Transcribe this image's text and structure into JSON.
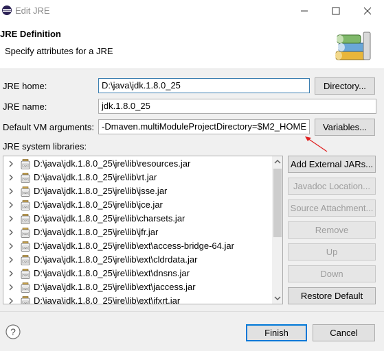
{
  "window": {
    "title": "Edit JRE"
  },
  "header": {
    "title": "JRE Definition",
    "subtitle": "Specify attributes for a JRE"
  },
  "form": {
    "jre_home_label": "JRE home:",
    "jre_home_value": "D:\\java\\jdk.1.8.0_25",
    "directory_button": "Directory...",
    "jre_name_label": "JRE name:",
    "jre_name_value": "jdk.1.8.0_25",
    "vm_args_label": "Default VM arguments:",
    "vm_args_value": "-Dmaven.multiModuleProjectDirectory=$M2_HOME",
    "variables_button": "Variables...",
    "libraries_label": "JRE system libraries:"
  },
  "libraries": [
    "D:\\java\\jdk.1.8.0_25\\jre\\lib\\resources.jar",
    "D:\\java\\jdk.1.8.0_25\\jre\\lib\\rt.jar",
    "D:\\java\\jdk.1.8.0_25\\jre\\lib\\jsse.jar",
    "D:\\java\\jdk.1.8.0_25\\jre\\lib\\jce.jar",
    "D:\\java\\jdk.1.8.0_25\\jre\\lib\\charsets.jar",
    "D:\\java\\jdk.1.8.0_25\\jre\\lib\\jfr.jar",
    "D:\\java\\jdk.1.8.0_25\\jre\\lib\\ext\\access-bridge-64.jar",
    "D:\\java\\jdk.1.8.0_25\\jre\\lib\\ext\\cldrdata.jar",
    "D:\\java\\jdk.1.8.0_25\\jre\\lib\\ext\\dnsns.jar",
    "D:\\java\\jdk.1.8.0_25\\jre\\lib\\ext\\jaccess.jar",
    "D:\\java\\jdk.1.8.0_25\\jre\\lib\\ext\\jfxrt.jar"
  ],
  "side_buttons": {
    "add_external": "Add External JARs...",
    "javadoc": "Javadoc Location...",
    "source": "Source Attachment...",
    "remove": "Remove",
    "up": "Up",
    "down": "Down",
    "restore": "Restore Default"
  },
  "footer": {
    "finish": "Finish",
    "cancel": "Cancel"
  },
  "colors": {
    "accent": "#0078d7",
    "annotation_arrow": "#e02020"
  }
}
